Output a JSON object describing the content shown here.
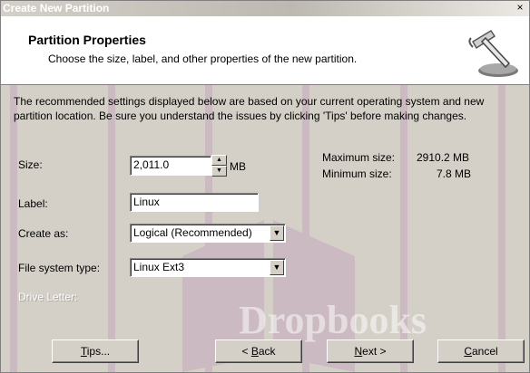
{
  "window": {
    "title": "Create New Partition",
    "close_glyph": "×"
  },
  "header": {
    "title": "Partition Properties",
    "subtitle": "Choose the size, label, and other properties of the new partition.",
    "icon": "hammer-icon"
  },
  "intro": "The recommended settings displayed below are based on your current operating system and new partition location. Be sure you understand the issues by clicking 'Tips' before making changes.",
  "form": {
    "size_label": "Size:",
    "size_value": "2,011.0",
    "size_unit": "MB",
    "label_label": "Label:",
    "label_value": "Linux",
    "create_as_label": "Create as:",
    "create_as_value": "Logical (Recommended)",
    "fs_label": "File system type:",
    "fs_value": "Linux Ext3",
    "drive_letter_label": "Drive Letter:"
  },
  "limits": {
    "max_label": "Maximum size:",
    "max_value": "2910.2 MB",
    "min_label": "Minimum size:",
    "min_value": "7.8 MB"
  },
  "watermark": {
    "text": "Dropbooks"
  },
  "buttons": {
    "tips_accel": "T",
    "tips_rest": "ips...",
    "back_pre": "< ",
    "back_accel": "B",
    "back_rest": "ack",
    "next_accel": "N",
    "next_rest": "ext >",
    "cancel_accel": "C",
    "cancel_rest": "ancel"
  },
  "colors": {
    "face": "#d4d0c8",
    "header_bg": "#ffffff",
    "watermark": "#a24aa0"
  }
}
